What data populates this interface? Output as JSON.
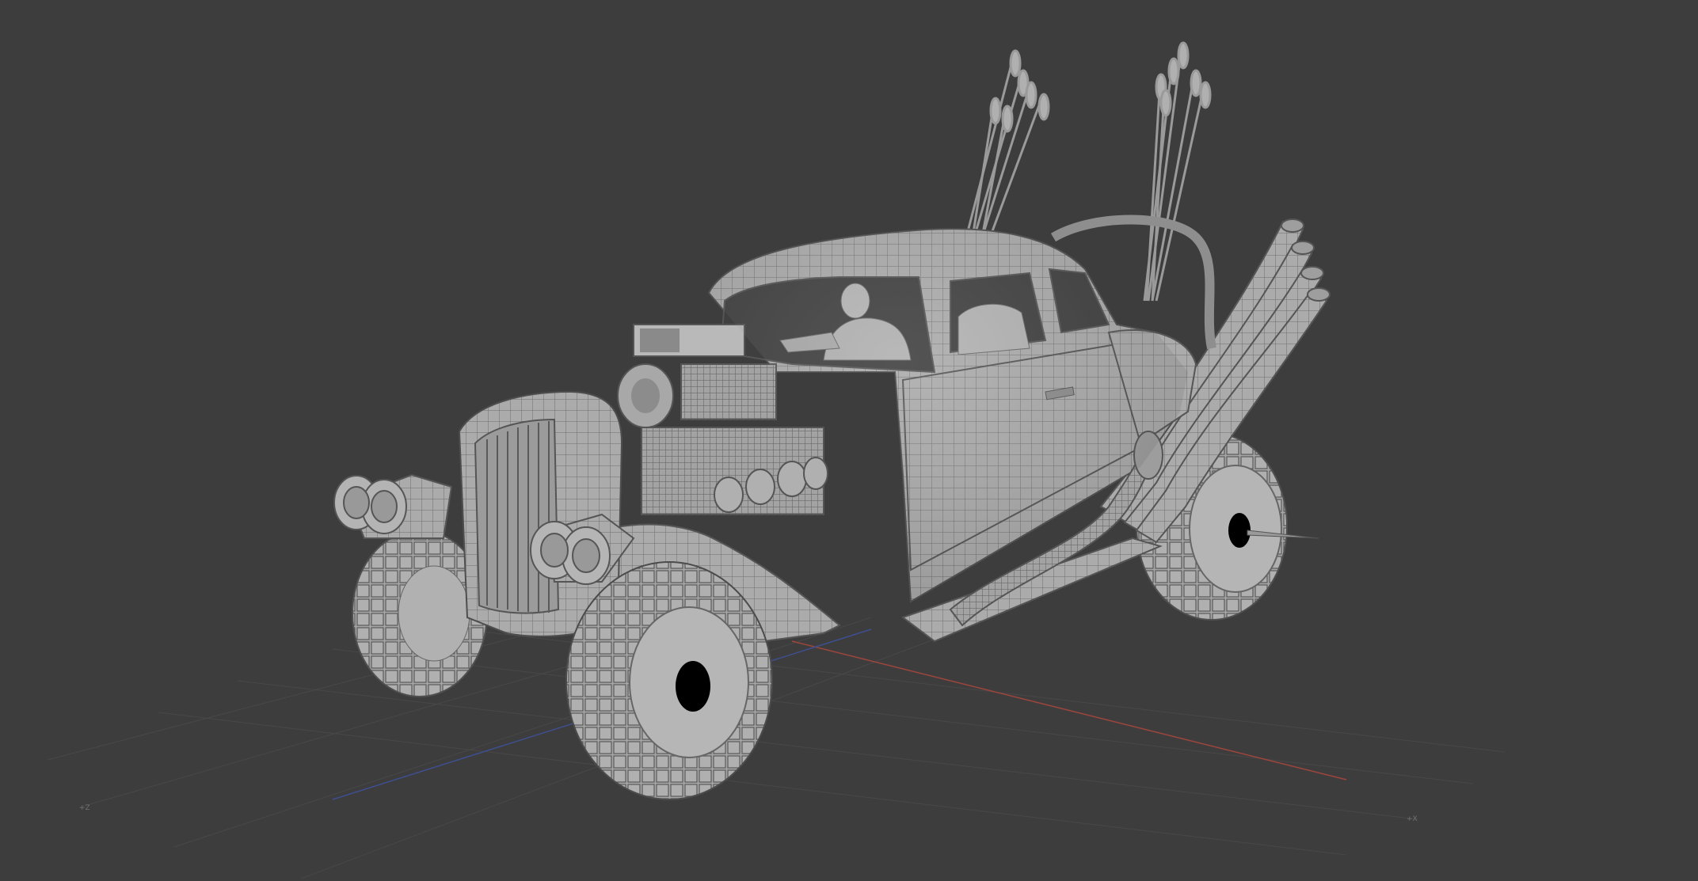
{
  "viewport": {
    "background": "#3d3d3d",
    "grid_color": "#4a4a4a",
    "x_axis_color": "#a0463c",
    "y_axis_color": "#3e4f8f",
    "model_base_color": "#a9a9a9",
    "wire_color": "#555555"
  },
  "axis_labels": {
    "left": "+Z",
    "right": "+X"
  },
  "icons": {
    "model": "hot-rod-car-model-icon"
  }
}
